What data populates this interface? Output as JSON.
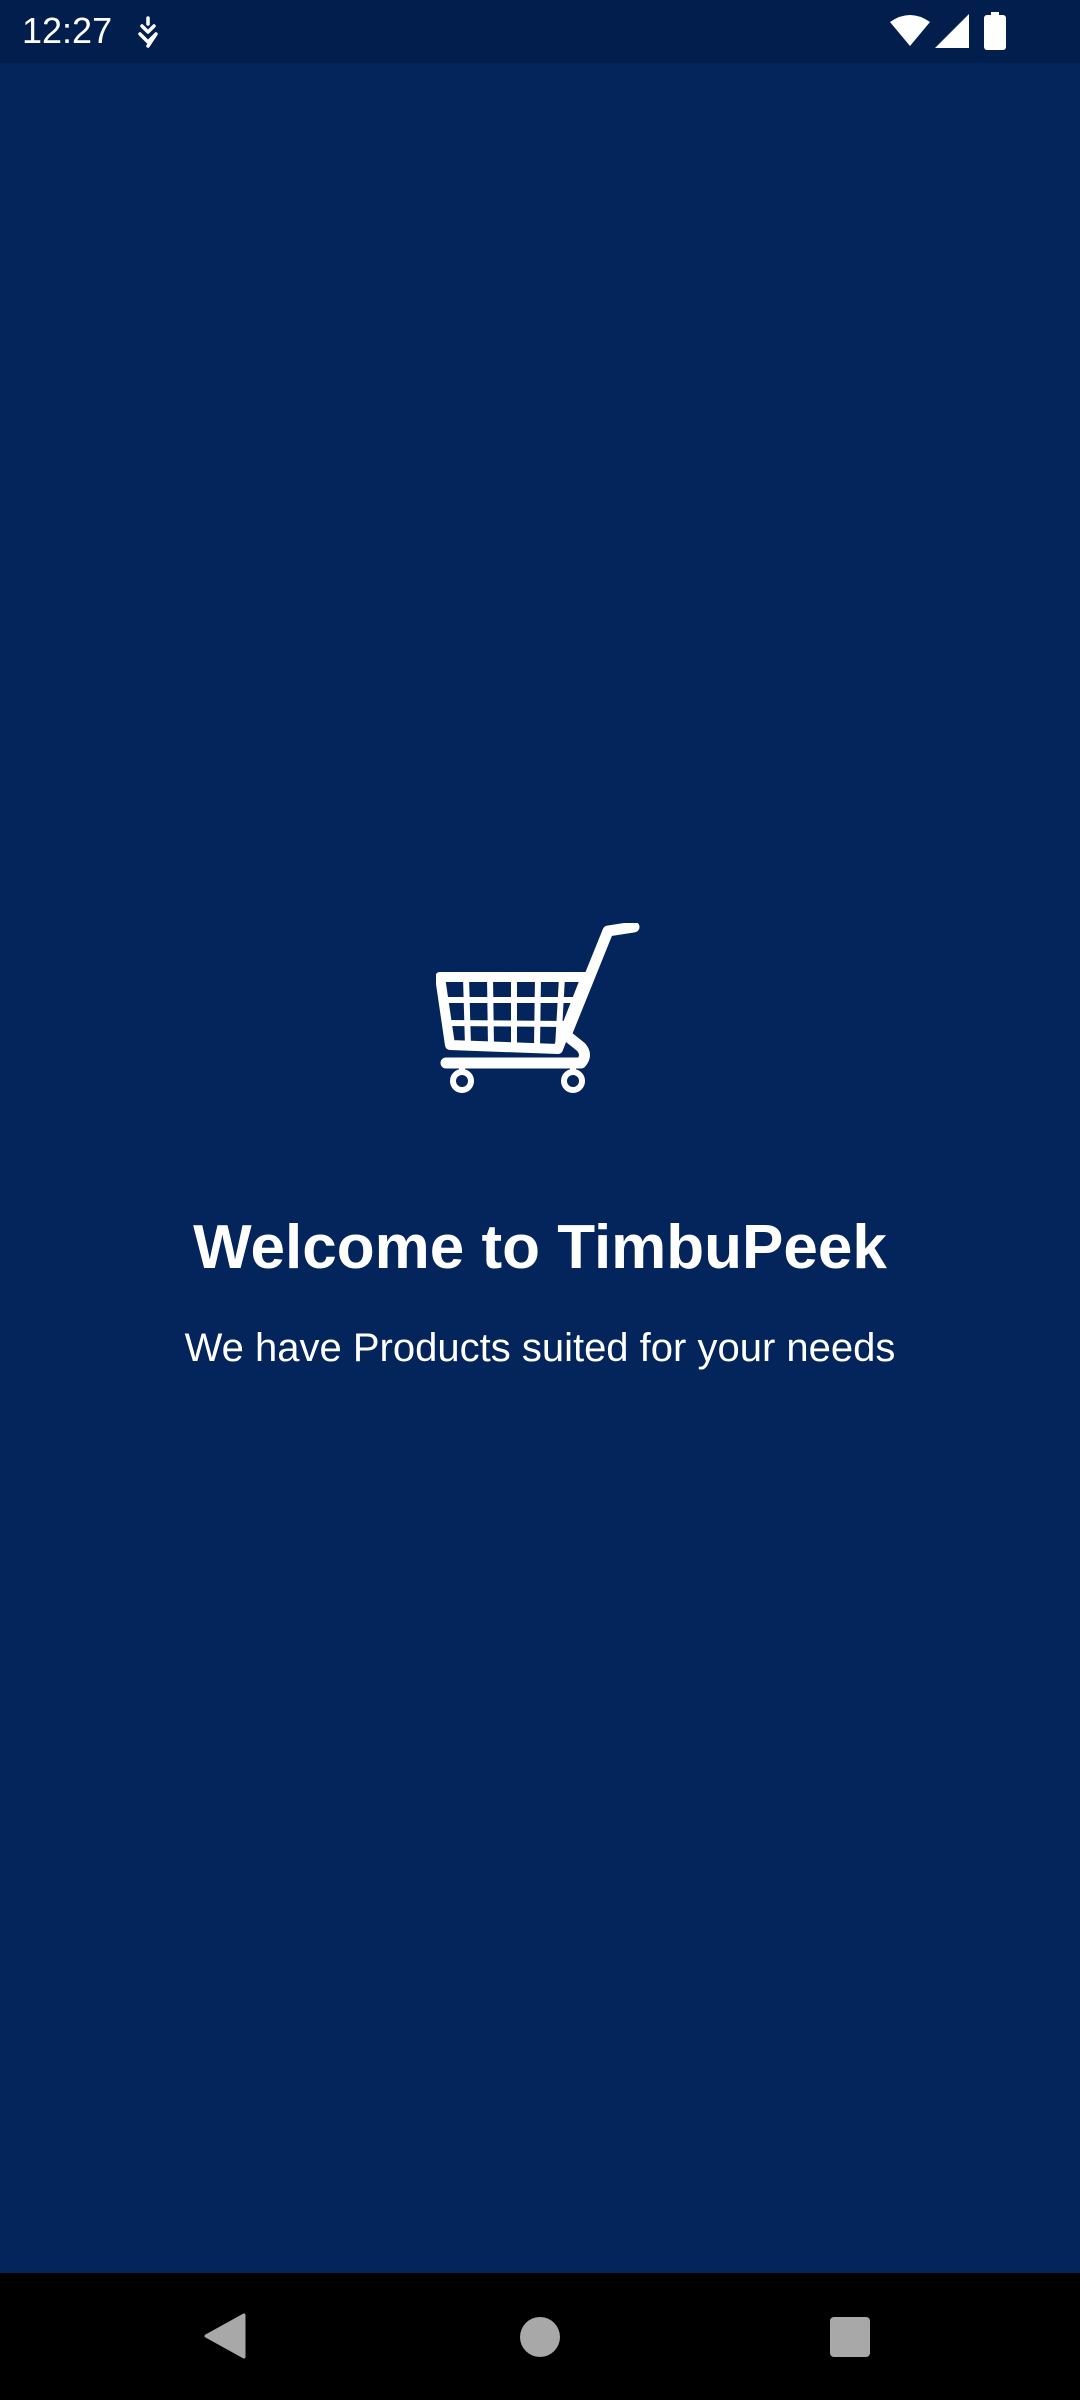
{
  "status_bar": {
    "time": "12:27",
    "icons": [
      "notification-icon",
      "wifi-icon",
      "signal-icon",
      "battery-icon"
    ]
  },
  "splash": {
    "icon": "shopping-cart-icon",
    "title": "Welcome to TimbuPeek",
    "subtitle": "We have Products suited for your needs"
  },
  "nav_bar": {
    "buttons": [
      "back-icon",
      "home-icon",
      "recents-icon"
    ]
  },
  "colors": {
    "background": "#03255b",
    "status_bar": "#011e4d",
    "text": "#ffffff",
    "nav_bar": "#000000",
    "nav_buttons": "#a8a8a8"
  }
}
